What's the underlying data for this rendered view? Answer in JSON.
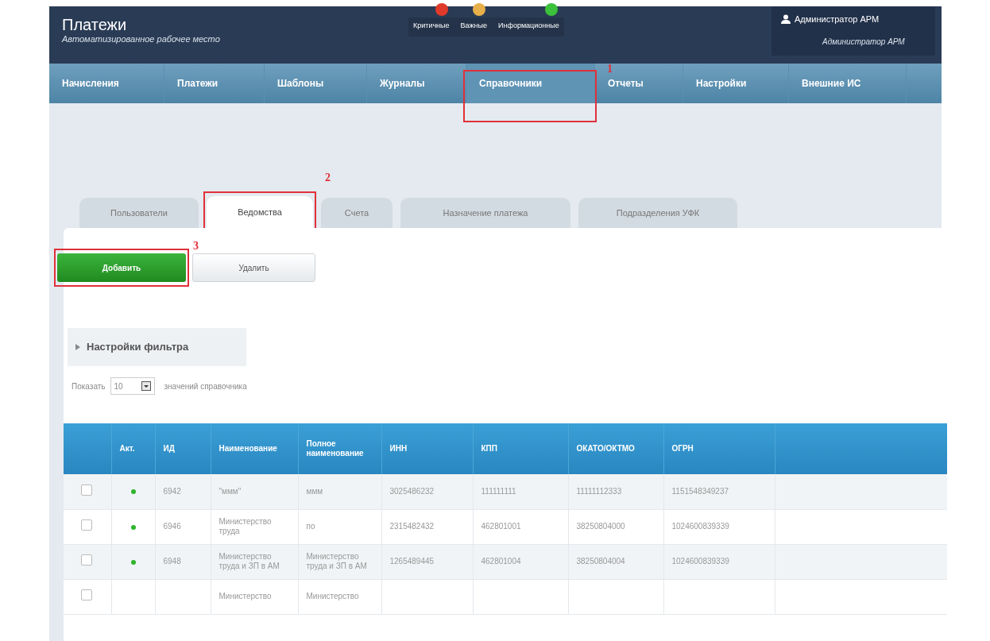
{
  "header": {
    "title": "Платежи",
    "subtitle": "Автоматизированное рабочее место"
  },
  "notifications": [
    {
      "label": "Критичные",
      "color": "#e03a2a"
    },
    {
      "label": "Важные",
      "color": "#e8b04a"
    },
    {
      "label": "Информационные",
      "color": "#3cc13c"
    }
  ],
  "user": {
    "name": "Администратор АРМ",
    "role": "Администратор АРМ"
  },
  "nav": [
    {
      "label": "Начисления",
      "selected": false
    },
    {
      "label": "Платежи",
      "selected": false
    },
    {
      "label": "Шаблоны",
      "selected": false
    },
    {
      "label": "Журналы",
      "selected": false
    },
    {
      "label": "Справочники",
      "selected": true,
      "annotation": "1"
    },
    {
      "label": "Отчеты",
      "selected": false
    },
    {
      "label": "Настройки",
      "selected": false
    },
    {
      "label": "Внешние ИС",
      "selected": false
    }
  ],
  "tabs": [
    {
      "label": "Пользователи",
      "selected": false
    },
    {
      "label": "Ведомства",
      "selected": true,
      "annotation": "2"
    },
    {
      "label": "Счета",
      "selected": false
    },
    {
      "label": "Назначение платежа",
      "selected": false
    },
    {
      "label": "Подразделения УФК",
      "selected": false
    }
  ],
  "buttons": [
    {
      "label": "Добавить",
      "kind": "primary",
      "annotation": "3"
    },
    {
      "label": "Удалить",
      "kind": "secondary"
    }
  ],
  "filter": {
    "label": "Настройки фильтра",
    "expanded": false
  },
  "page_size": {
    "prefix": "Показать",
    "value": "10",
    "suffix": "значений справочника"
  },
  "table": {
    "columns": [
      "",
      "Акт.",
      "ИД",
      "Наименование",
      "Полное наименование",
      "ИНН",
      "КПП",
      "ОКАТО/ОКТМО",
      "ОГРН"
    ],
    "rows": [
      {
        "checked": false,
        "active": true,
        "cells": [
          "",
          "",
          "6942",
          "\"ммм\"",
          "ммм",
          "3025486232",
          "111111111",
          "11111112333",
          "1151548349237"
        ]
      },
      {
        "checked": false,
        "active": true,
        "cells": [
          "",
          "",
          "6946",
          "Министерство труда",
          "по",
          "2315482432",
          "462801001",
          "38250804000",
          "1024600839339"
        ]
      },
      {
        "checked": false,
        "active": true,
        "cells": [
          "",
          "",
          "6948",
          "Министерство труда и ЗП в АМ",
          "Министерство труда и ЗП в АМ",
          "1265489445",
          "462801004",
          "38250804004",
          "1024600839339"
        ]
      },
      {
        "checked": false,
        "cells": [
          "",
          "",
          "",
          "Министерство",
          "Министерство",
          "",
          "",
          "",
          ""
        ]
      }
    ]
  }
}
